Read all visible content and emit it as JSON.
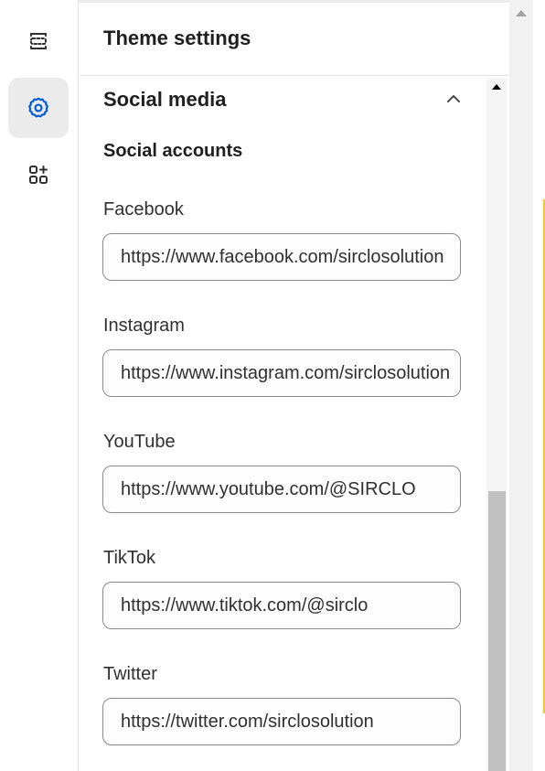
{
  "sidebar": {
    "items": [
      {
        "icon": "sections-icon",
        "label": "Sections"
      },
      {
        "icon": "gear-icon",
        "label": "Theme settings",
        "active": true
      },
      {
        "icon": "add-apps-icon",
        "label": "Apps"
      }
    ]
  },
  "panel": {
    "title": "Theme settings",
    "section": {
      "title": "Social media",
      "expanded": true,
      "subheading": "Social accounts",
      "fields": [
        {
          "label": "Facebook",
          "value": "https://www.facebook.com/sirclosolution"
        },
        {
          "label": "Instagram",
          "value": "https://www.instagram.com/sirclosolution"
        },
        {
          "label": "YouTube",
          "value": "https://www.youtube.com/@SIRCLO"
        },
        {
          "label": "TikTok",
          "value": "https://www.tiktok.com/@sirclo"
        },
        {
          "label": "Twitter",
          "value": "https://twitter.com/sirclosolution"
        }
      ]
    }
  },
  "colors": {
    "accent": "#005bd3",
    "active_bg": "#ebebeb",
    "border": "#8a8a8a",
    "text": "#303030"
  }
}
